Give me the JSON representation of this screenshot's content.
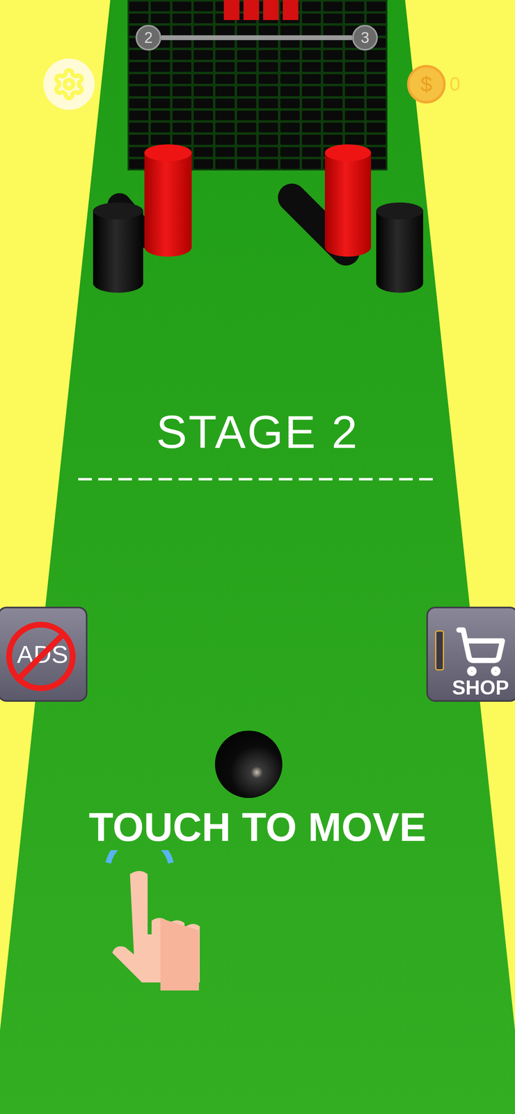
{
  "progress": {
    "current": "2",
    "next": "3",
    "level": 0
  },
  "coins": {
    "symbol": "$",
    "count": "0"
  },
  "stage": {
    "label": "STAGE 2"
  },
  "buttons": [
    {
      "label": "ADS",
      "kind": "no-ads"
    },
    {
      "label": "SHOP",
      "kind": "shop"
    }
  ],
  "hint": "TOUCH TO MOVE"
}
